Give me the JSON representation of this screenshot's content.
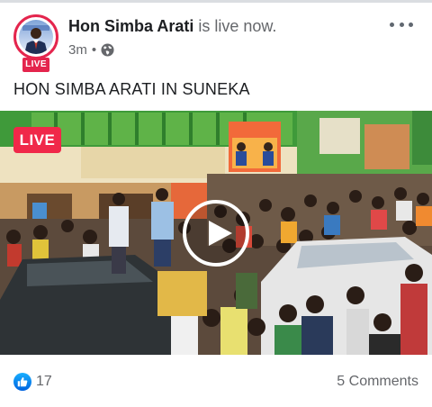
{
  "post": {
    "author_name": "Hon Simba Arati",
    "status_text": "is live now.",
    "time_ago": "3m",
    "meta_separator": "•",
    "privacy_icon": "globe-icon",
    "avatar_live_label": "LIVE",
    "caption": "HON SIMBA ARATI IN SUNEKA"
  },
  "video": {
    "live_label": "LIVE",
    "play_icon": "play-icon"
  },
  "footer": {
    "reaction_icon": "like-icon",
    "reaction_count": "17",
    "comments_label": "5 Comments"
  },
  "colors": {
    "live_red": "#f02849",
    "avatar_ring": "#e4254d",
    "like_blue": "#0866ff",
    "secondary_text": "#65676b"
  }
}
